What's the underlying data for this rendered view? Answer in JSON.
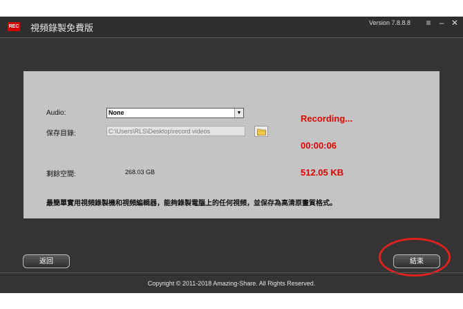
{
  "titlebar": {
    "logo_text": "REC",
    "title": "視頻錄製免費版",
    "version": "Version 7.8.8.8",
    "menu_glyph": "≡",
    "minimize_glyph": "–",
    "close_glyph": "✕"
  },
  "form": {
    "audio_label": "Audio:",
    "audio_value": "None",
    "save_dir_label": "保存目錄:",
    "save_dir_value": "C:\\Users\\RLS\\Desktop\\record videos",
    "free_space_label": "剩餘空間:",
    "free_space_value": "268.03 GB"
  },
  "status": {
    "recording": "Recording...",
    "elapsed": "00:00:06",
    "size": "512.05 KB"
  },
  "description": "最簡單實用視頻錄製機和視頻編輯器，能夠錄製電腦上的任何視頻，並保存為高清原畫質格式。",
  "buttons": {
    "back": "返回",
    "end": "結束"
  },
  "footer": {
    "copyright": "Copyright © 2011-2018 Amazing-Share. All Rights Reserved."
  },
  "colors": {
    "accent": "#e00000",
    "window_bg": "#343434",
    "panel_bg": "#c4c4c4"
  }
}
